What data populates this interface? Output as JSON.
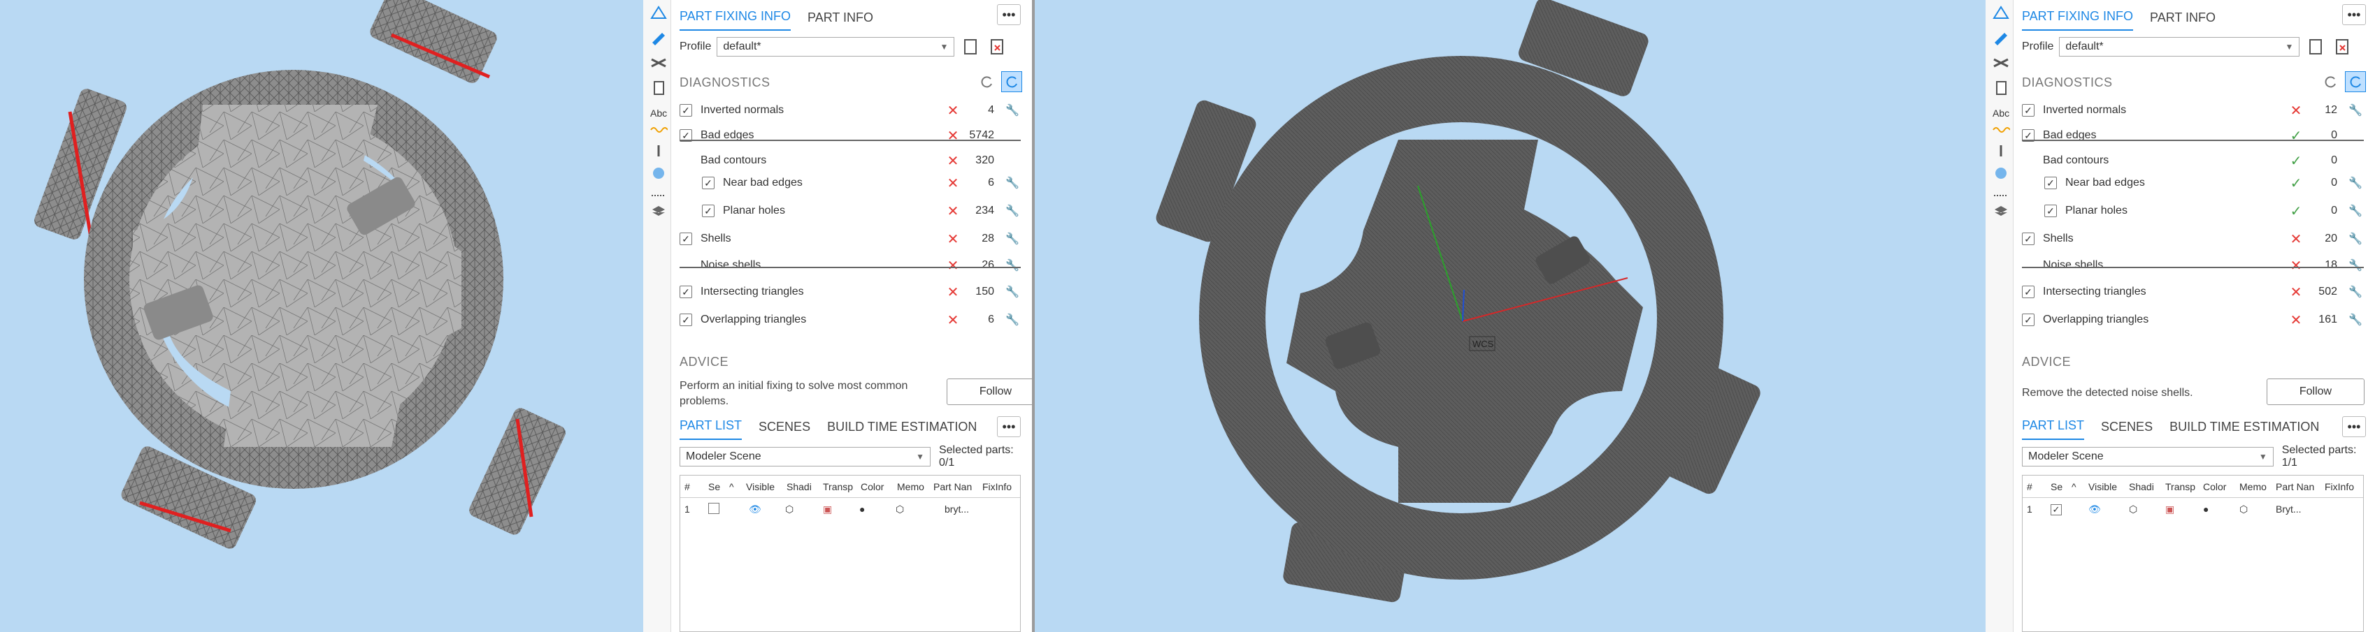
{
  "left_panel": {
    "tabs": [
      "PART FIXING INFO",
      "PART INFO"
    ],
    "more_label": "•••",
    "profile_label": "Profile",
    "profile_value": "default*",
    "diagnostics_title": "DIAGNOSTICS",
    "diagnostics": [
      {
        "label": "Inverted normals",
        "checkbox": true,
        "status": "bad",
        "count": "4",
        "wrench": true
      },
      {
        "label": "Bad edges",
        "checkbox": true,
        "status": "bad",
        "count": "5742",
        "wrench": false
      },
      {
        "label": "Bad contours",
        "checkbox": false,
        "status": "bad",
        "count": "320",
        "wrench": false
      },
      {
        "label": "Near bad edges",
        "checkbox": true,
        "status": "bad",
        "count": "6",
        "wrench": true
      },
      {
        "label": "Planar holes",
        "checkbox": true,
        "status": "bad",
        "count": "234",
        "wrench": true
      },
      {
        "label": "Shells",
        "checkbox": true,
        "status": "bad",
        "count": "28",
        "wrench": true
      },
      {
        "label": "Noise shells",
        "checkbox": false,
        "status": "bad",
        "count": "26",
        "wrench": true
      },
      {
        "label": "Intersecting triangles",
        "checkbox": true,
        "status": "bad",
        "count": "150",
        "wrench": true
      },
      {
        "label": "Overlapping triangles",
        "checkbox": true,
        "status": "bad",
        "count": "6",
        "wrench": true
      }
    ],
    "advice_title": "ADVICE",
    "advice_text": "Perform an initial fixing to solve most common problems.",
    "follow_label": "Follow",
    "bottom_tabs": [
      "PART LIST",
      "SCENES",
      "BUILD TIME ESTIMATION"
    ],
    "scene_value": "Modeler Scene",
    "selected_parts": "Selected parts:  0/1",
    "table_headers": [
      "#",
      "Se",
      "^",
      "Visible",
      "Shadi",
      "Transp",
      "Color",
      "Memo",
      "Part Nan",
      "FixInfo"
    ],
    "table_row": {
      "num": "1",
      "name": "bryt..."
    }
  },
  "right_panel": {
    "tabs": [
      "PART FIXING INFO",
      "PART INFO"
    ],
    "more_label": "•••",
    "profile_label": "Profile",
    "profile_value": "default*",
    "diagnostics_title": "DIAGNOSTICS",
    "diagnostics": [
      {
        "label": "Inverted normals",
        "checkbox": true,
        "status": "bad",
        "count": "12",
        "wrench": true
      },
      {
        "label": "Bad edges",
        "checkbox": true,
        "status": "ok",
        "count": "0",
        "wrench": false
      },
      {
        "label": "Bad contours",
        "checkbox": false,
        "status": "ok",
        "count": "0",
        "wrench": false
      },
      {
        "label": "Near bad edges",
        "checkbox": true,
        "status": "ok",
        "count": "0",
        "wrench": true
      },
      {
        "label": "Planar holes",
        "checkbox": true,
        "status": "ok",
        "count": "0",
        "wrench": true
      },
      {
        "label": "Shells",
        "checkbox": true,
        "status": "bad",
        "count": "20",
        "wrench": true
      },
      {
        "label": "Noise shells",
        "checkbox": false,
        "status": "bad",
        "count": "18",
        "wrench": true
      },
      {
        "label": "Intersecting triangles",
        "checkbox": true,
        "status": "bad",
        "count": "502",
        "wrench": true
      },
      {
        "label": "Overlapping triangles",
        "checkbox": true,
        "status": "bad",
        "count": "161",
        "wrench": true
      }
    ],
    "advice_title": "ADVICE",
    "advice_text": "Remove the detected noise shells.",
    "follow_label": "Follow",
    "bottom_tabs": [
      "PART LIST",
      "SCENES",
      "BUILD TIME ESTIMATION"
    ],
    "scene_value": "Modeler Scene",
    "selected_parts": "Selected parts:  1/1",
    "table_headers": [
      "#",
      "Se",
      "^",
      "Visible",
      "Shadi",
      "Transp",
      "Color",
      "Memo",
      "Part Nan",
      "FixInfo"
    ],
    "table_row": {
      "num": "1",
      "name": "Bryt..."
    }
  },
  "viewport": {
    "axis_label": "WCS"
  },
  "colors": {
    "accent": "#1e88e5",
    "bad": "#e53935",
    "ok": "#43a047",
    "background": "#b9d9f3",
    "mesh": "#5b5b5b"
  }
}
